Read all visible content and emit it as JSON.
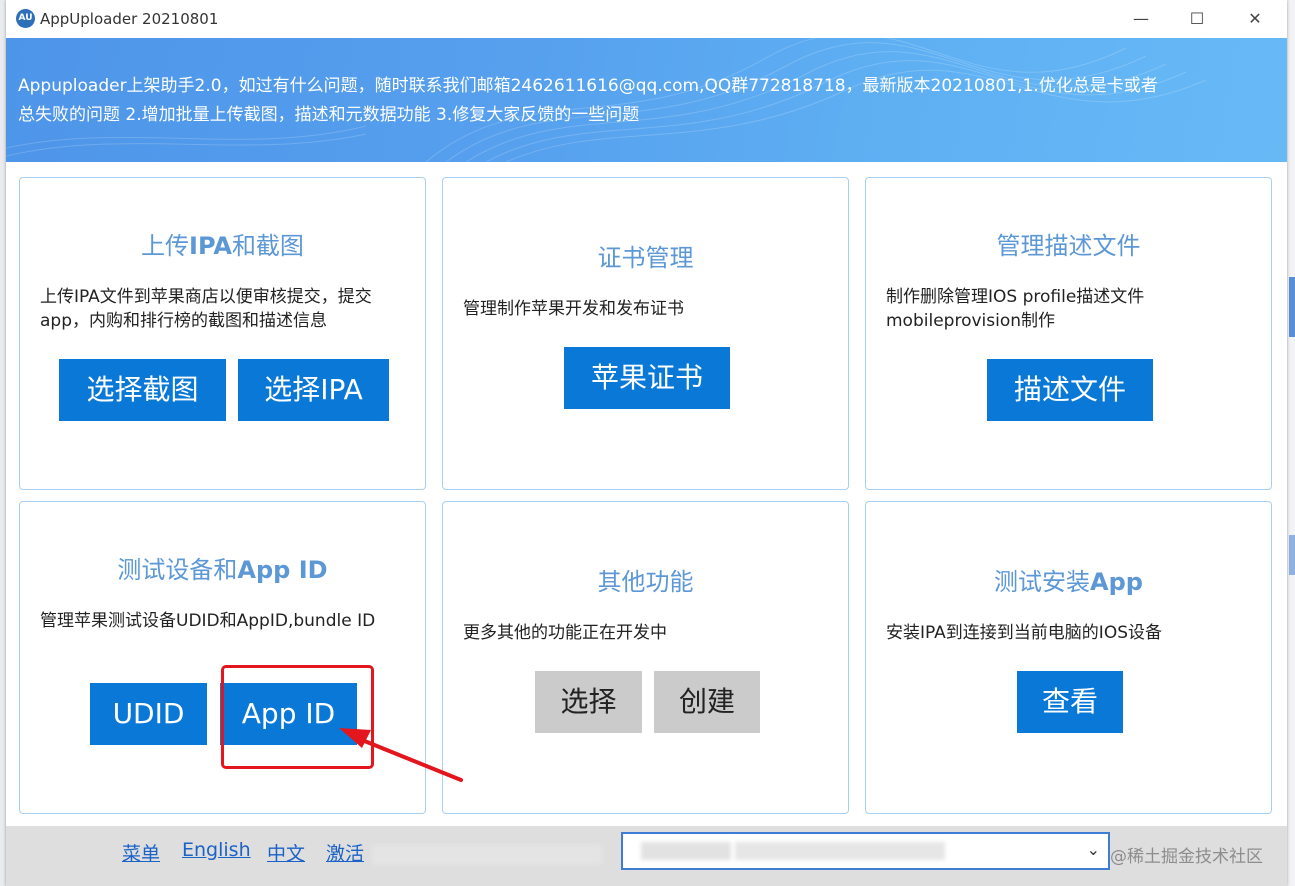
{
  "window": {
    "icon_text": "AU",
    "title": "AppUploader 20210801",
    "minimize_glyph": "—",
    "maximize_glyph": "☐",
    "close_glyph": "✕"
  },
  "banner": {
    "line1": "Appuploader上架助手2.0，如过有什么问题，随时联系我们邮箱2462611616@qq.com,QQ群772818718，最新版本20210801,1.优化总是卡或者",
    "line2": "总失败的问题 2.增加批量上传截图，描述和元数据功能 3.修复大家反馈的一些问题"
  },
  "cards": [
    {
      "title_prefix": "上传",
      "title_bold": "IPA",
      "title_suffix": "和截图",
      "desc": "上传IPA文件到苹果商店以便审核提交，提交app，内购和排行榜的截图和描述信息",
      "buttons": [
        "选择截图",
        "选择IPA"
      ]
    },
    {
      "title_prefix": "证书管理",
      "title_bold": "",
      "title_suffix": "",
      "desc": "管理制作苹果开发和发布证书",
      "buttons": [
        "苹果证书"
      ]
    },
    {
      "title_prefix": "管理描述文件",
      "title_bold": "",
      "title_suffix": "",
      "desc": "制作删除管理IOS profile描述文件mobileprovision制作",
      "buttons": [
        "描述文件"
      ]
    },
    {
      "title_prefix": "测试设备和",
      "title_bold": "App ID",
      "title_suffix": "",
      "desc": "管理苹果测试设备UDID和AppID,bundle ID",
      "buttons": [
        "UDID",
        "App ID"
      ]
    },
    {
      "title_prefix": "其他功能",
      "title_bold": "",
      "title_suffix": "",
      "desc": "更多其他的功能正在开发中",
      "buttons": [
        "选择",
        "创建"
      ]
    },
    {
      "title_prefix": "测试安装",
      "title_bold": "App",
      "title_suffix": "",
      "desc": "安装IPA到连接到当前电脑的IOS设备",
      "buttons": [
        "查看"
      ]
    }
  ],
  "footer": {
    "links": [
      "菜单",
      "English",
      "中文",
      "激活"
    ],
    "dropdown_arrow": "⌄",
    "watermark": "@稀土掘金技术社区"
  },
  "colors": {
    "accent_button": "#0a78d7",
    "disabled_button": "#cbcbcb",
    "card_title": "#5c97d6",
    "annotation": "#e3161d"
  }
}
